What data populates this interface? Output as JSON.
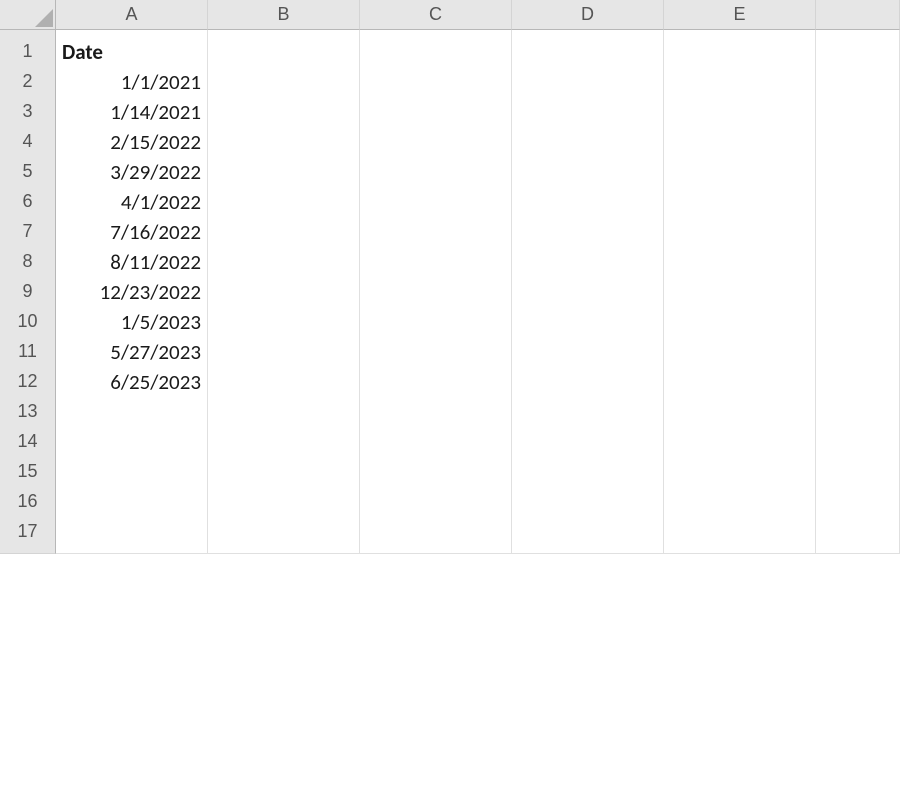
{
  "columns": [
    "A",
    "B",
    "C",
    "D",
    "E",
    ""
  ],
  "rows": [
    "1",
    "2",
    "3",
    "4",
    "5",
    "6",
    "7",
    "8",
    "9",
    "10",
    "11",
    "12",
    "13",
    "14",
    "15",
    "16",
    "17"
  ],
  "header": {
    "A": {
      "value": "Date",
      "bold": true,
      "align": "left"
    }
  },
  "data": [
    {
      "A": "1/1/2021"
    },
    {
      "A": "1/14/2021"
    },
    {
      "A": "2/15/2022"
    },
    {
      "A": "3/29/2022"
    },
    {
      "A": "4/1/2022"
    },
    {
      "A": "7/16/2022"
    },
    {
      "A": "8/11/2022"
    },
    {
      "A": "12/23/2022"
    },
    {
      "A": "1/5/2023"
    },
    {
      "A": "5/27/2023"
    },
    {
      "A": "6/25/2023"
    },
    {},
    {},
    {},
    {},
    {}
  ]
}
